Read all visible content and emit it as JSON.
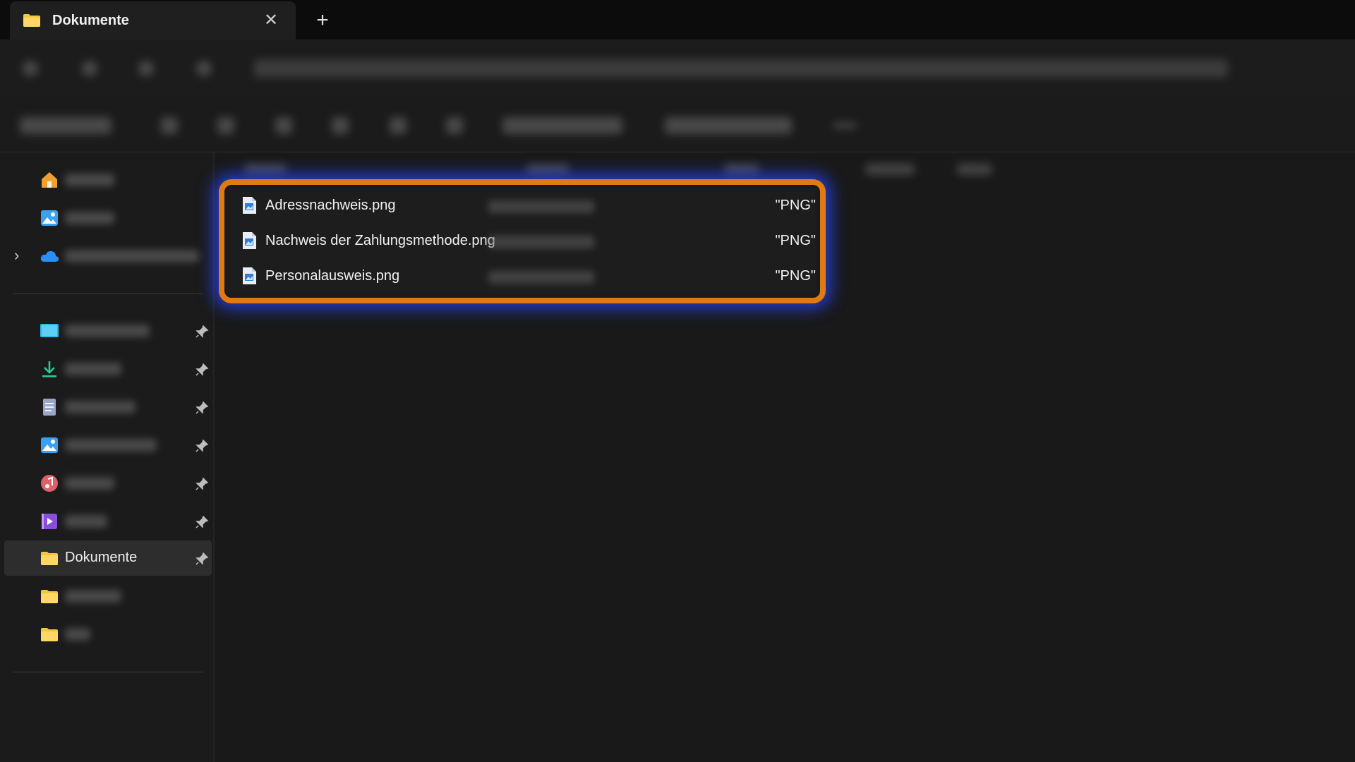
{
  "window": {
    "tab_title": "Dokumente",
    "close_glyph": "✕",
    "new_tab_glyph": "+"
  },
  "sidebar": {
    "expand_glyph": "›",
    "pinned": [
      {
        "icon": "desktop-icon",
        "label": ""
      },
      {
        "icon": "download-icon",
        "label": ""
      },
      {
        "icon": "document-icon",
        "label": ""
      },
      {
        "icon": "pictures-icon",
        "label": ""
      },
      {
        "icon": "music-icon",
        "label": ""
      },
      {
        "icon": "videos-icon",
        "label": ""
      }
    ],
    "selected_item": {
      "icon": "folder-icon",
      "label": "Dokumente"
    },
    "folders": [
      {
        "icon": "folder-icon",
        "label": ""
      },
      {
        "icon": "folder-icon",
        "label": ""
      }
    ]
  },
  "files": [
    {
      "name": "Adressnachweis.png",
      "type": "\"PNG\""
    },
    {
      "name": "Nachweis der Zahlungsmethode.png",
      "type": "\"PNG\""
    },
    {
      "name": "Personalausweis.png",
      "type": "\"PNG\""
    }
  ],
  "colors": {
    "highlight_border": "#e07a12",
    "highlight_glow": "#2846ff",
    "folder_yellow": "#f4c542",
    "file_icon_blue": "#2f7fd8"
  }
}
